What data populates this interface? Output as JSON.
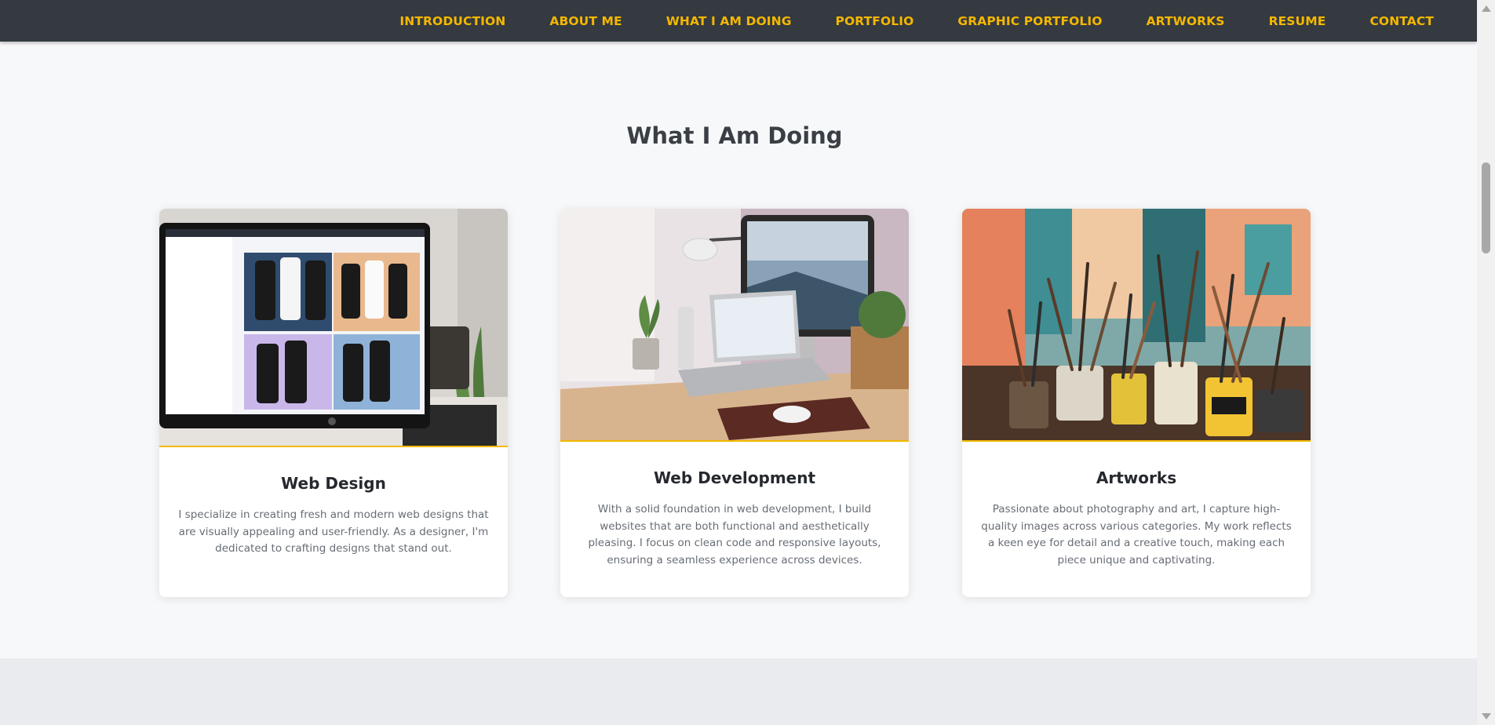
{
  "nav": {
    "items": [
      "INTRODUCTION",
      "ABOUT ME",
      "WHAT I AM DOING",
      "PORTFOLIO",
      "GRAPHIC PORTFOLIO",
      "ARTWORKS",
      "RESUME",
      "CONTACT"
    ]
  },
  "section": {
    "title": "What I Am Doing"
  },
  "cards": [
    {
      "title": "Web Design",
      "text": "I specialize in creating fresh and modern web designs that are visually appealing and user-friendly. As a designer, I'm dedicated to crafting designs that stand out.",
      "image_alt": "monitor showing mobile app design layouts"
    },
    {
      "title": "Web Development",
      "text": "With a solid foundation in web development, I build websites that are both functional and aesthetically pleasing. I focus on clean code and responsive layouts, ensuring a seamless experience across devices.",
      "image_alt": "laptop and desktop monitor on wooden desk"
    },
    {
      "title": "Artworks",
      "text": "Passionate about photography and art, I capture high-quality images across various categories. My work reflects a keen eye for detail and a creative touch, making each piece unique and captivating.",
      "image_alt": "paint brushes in jars on artist table"
    }
  ],
  "colors": {
    "nav_bg": "#343a40",
    "accent": "#f5b700",
    "page_bg": "#f7f8fa"
  }
}
